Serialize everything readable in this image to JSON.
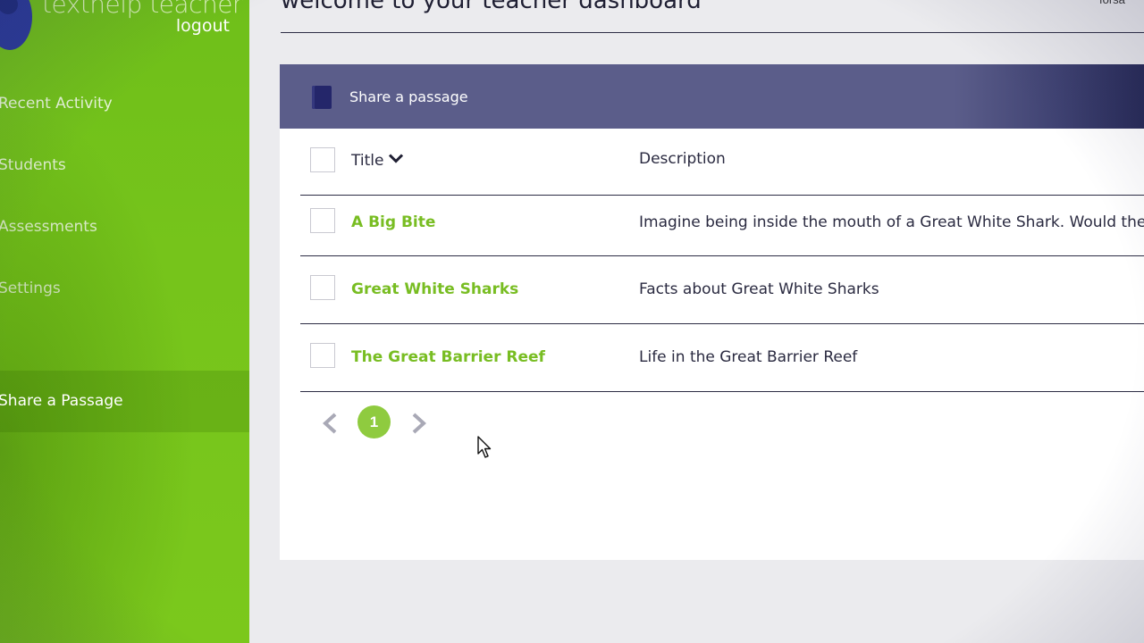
{
  "sidebar": {
    "brand": "texthelp teacher",
    "logout": "logout",
    "items": [
      {
        "label": "Recent Activity"
      },
      {
        "label": "Students"
      },
      {
        "label": "Assessments"
      },
      {
        "label": "Settings"
      },
      {
        "label": "Share a Passage",
        "active": true
      }
    ]
  },
  "header": {
    "title": "welcome to your teacher dashboard",
    "user_corner": "forsa"
  },
  "panel": {
    "title": "Share a passage",
    "icon": "book-icon",
    "columns": {
      "title": "Title",
      "description": "Description"
    },
    "rows": [
      {
        "title": "A Big Bite",
        "description": "Imagine being inside the mouth of a Great White Shark. Would the"
      },
      {
        "title": "Great White Sharks",
        "description": "Facts about Great White Sharks"
      },
      {
        "title": "The Great Barrier Reef",
        "description": "Life in the Great Barrier Reef"
      }
    ],
    "pagination": {
      "current_page": "1"
    }
  },
  "colors": {
    "sidebar_green": "#76c41b",
    "header_band": "#5b5d8a",
    "link_green": "#78bd22",
    "page_badge": "#8fcb3f"
  }
}
